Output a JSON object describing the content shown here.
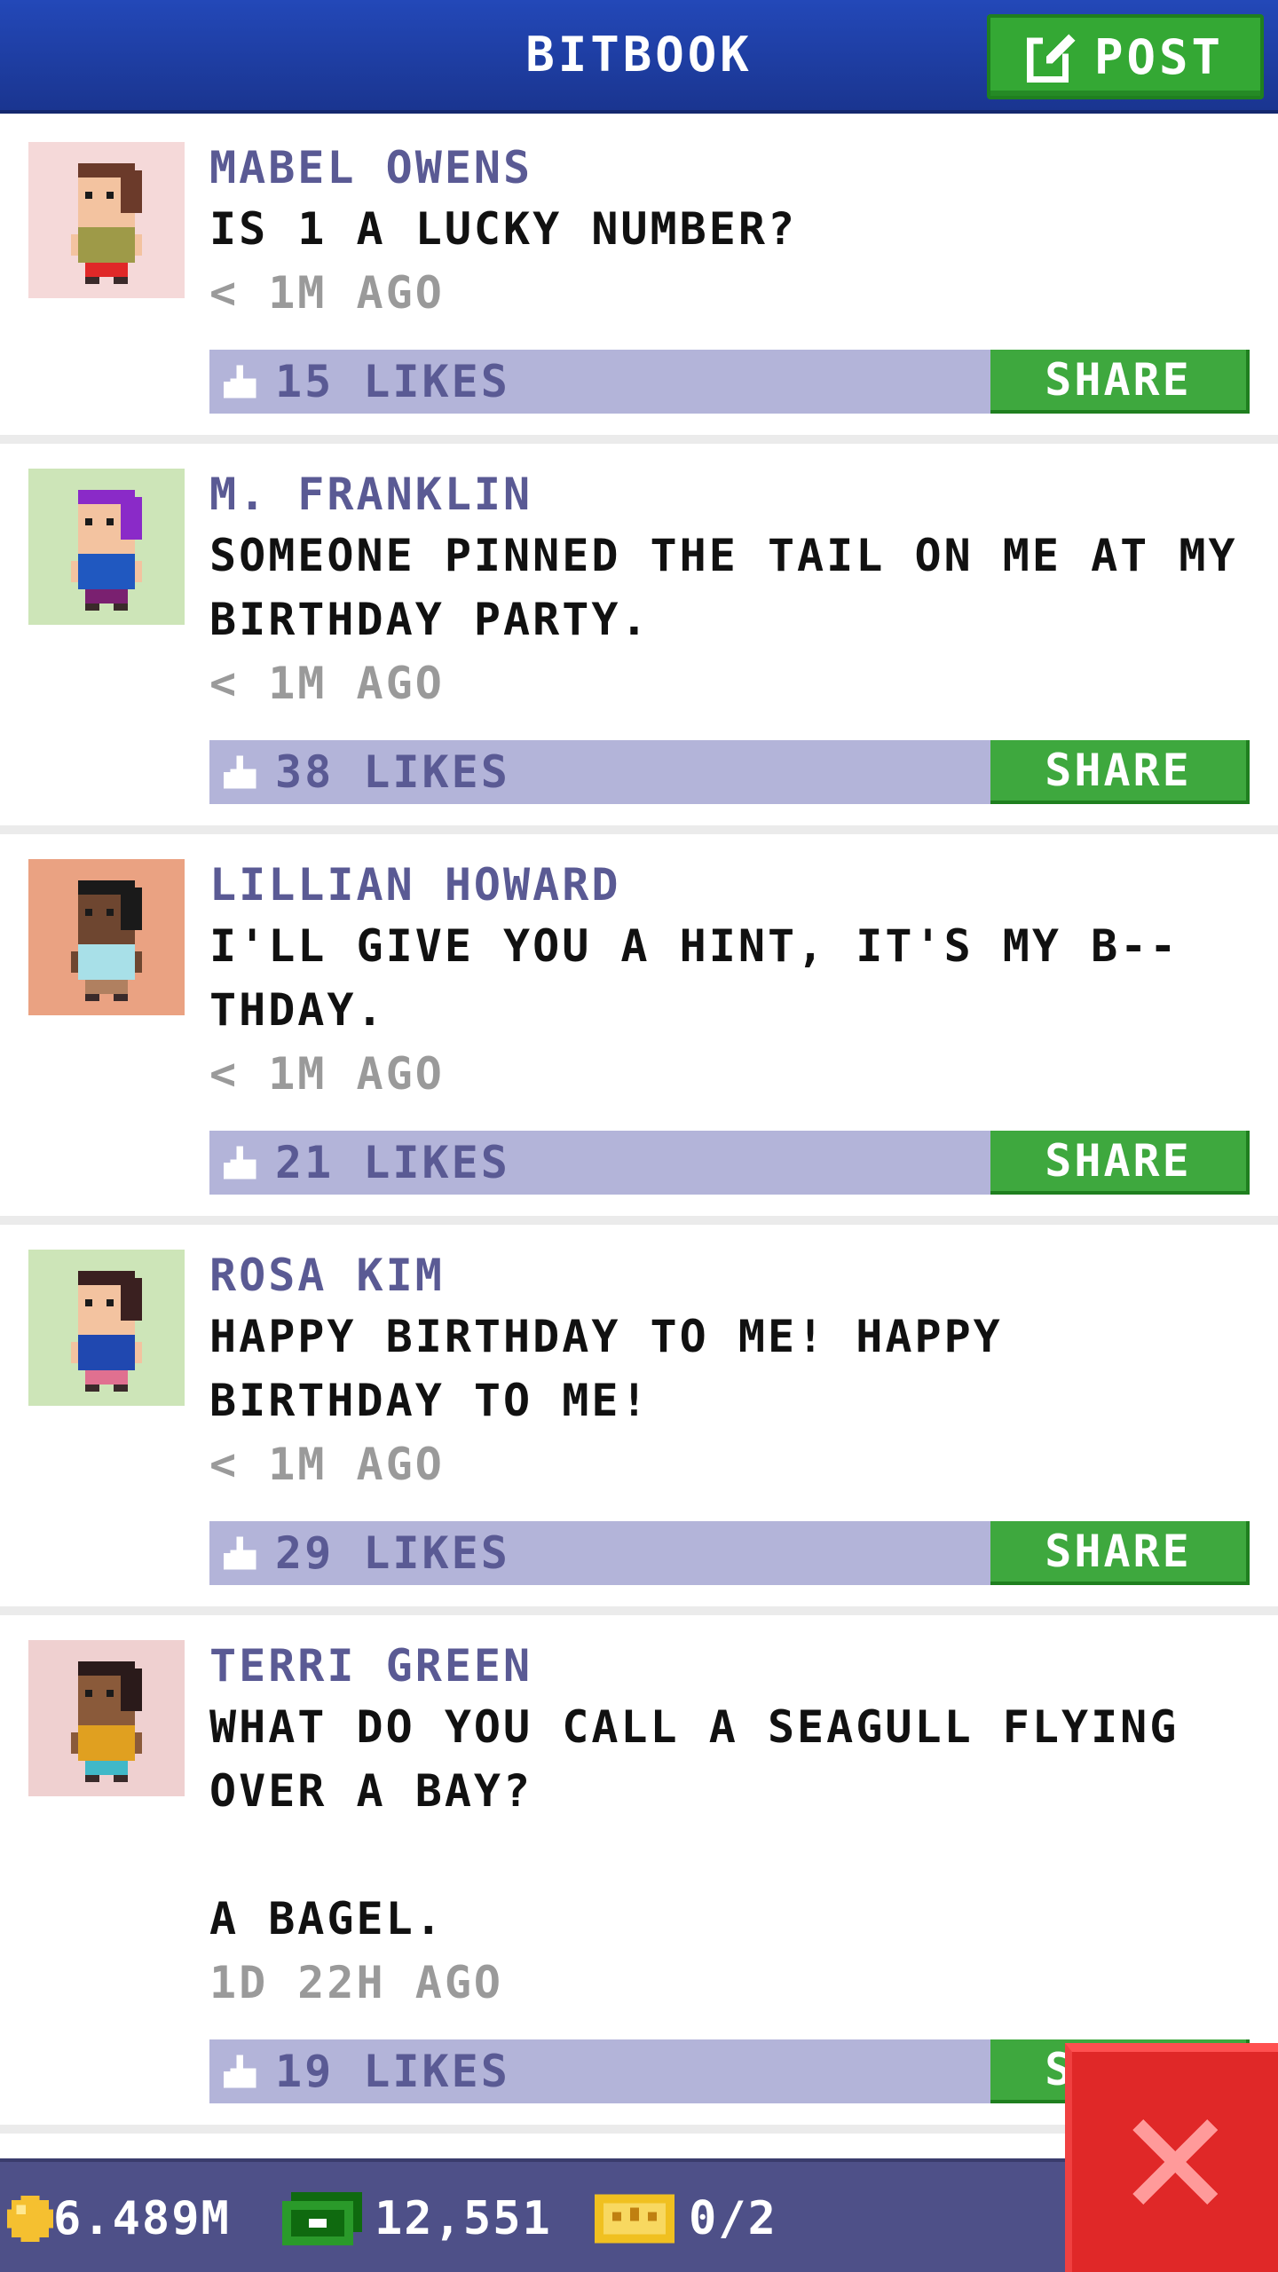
{
  "header": {
    "title": "BITBOOK",
    "post_label": "POST"
  },
  "posts": [
    {
      "author": "MABEL OWENS",
      "message": "IS 1 A LUCKY NUMBER?",
      "time": "< 1M AGO",
      "likes": "15 LIKES",
      "share_label": "SHARE",
      "avatar_bg": "#f5d9d9",
      "shirt": "#9e9a48",
      "pants": "#e02828",
      "skin": "#f3c3a0",
      "hair": "#6b3a2a"
    },
    {
      "author": "M. FRANKLIN",
      "message": "SOMEONE PINNED THE TAIL ON ME AT MY BIRTHDAY PARTY.",
      "time": "< 1M AGO",
      "likes": "38 LIKES",
      "share_label": "SHARE",
      "avatar_bg": "#cde5b8",
      "shirt": "#2058c0",
      "pants": "#7a2070",
      "skin": "#f3c3a0",
      "hair": "#8a2ac8"
    },
    {
      "author": "LILLIAN HOWARD",
      "message": "I'LL GIVE YOU A HINT, IT'S MY B--THDAY.",
      "time": "< 1M AGO",
      "likes": "21 LIKES",
      "share_label": "SHARE",
      "avatar_bg": "#eaa282",
      "shirt": "#a8e0e8",
      "pants": "#b08060",
      "skin": "#6e4630",
      "hair": "#1a1a1a"
    },
    {
      "author": "ROSA KIM",
      "message": "HAPPY BIRTHDAY TO ME! HAPPY BIRTHDAY TO ME!",
      "time": "< 1M AGO",
      "likes": "29 LIKES",
      "share_label": "SHARE",
      "avatar_bg": "#cde5b8",
      "shirt": "#2048b0",
      "pants": "#e07090",
      "skin": "#f3c3a0",
      "hair": "#3a2020"
    },
    {
      "author": "TERRI GREEN",
      "message": "WHAT DO YOU CALL A SEAGULL FLYING OVER A BAY?\n\nA BAGEL.",
      "time": "1D 22H AGO",
      "likes": "19 LIKES",
      "share_label": "SHARE",
      "avatar_bg": "#efd0d0",
      "shirt": "#e0a020",
      "pants": "#40b8c8",
      "skin": "#8a5a3a",
      "hair": "#2a1a1a"
    }
  ],
  "status": {
    "coins": "6.489M",
    "cash": "12,551",
    "tickets": "0/2"
  },
  "colors": {
    "header": "#1a3590",
    "green": "#34a834",
    "like_bar": "#b3b4d9",
    "close": "#e02828"
  },
  "icons": {
    "post": "edit-icon",
    "like": "thumbs-up-icon",
    "coin": "coin-icon",
    "cash": "cash-icon",
    "ticket": "ticket-icon",
    "close": "close-icon"
  }
}
